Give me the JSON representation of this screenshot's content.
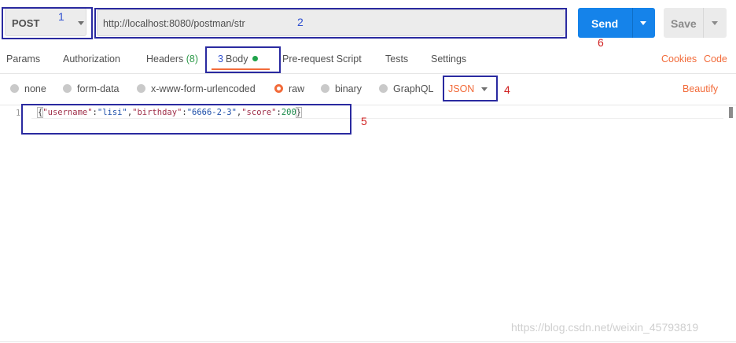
{
  "request": {
    "method": "POST",
    "url": "http://localhost:8080/postman/str",
    "send_label": "Send",
    "save_label": "Save"
  },
  "tabs": [
    {
      "label": "Params"
    },
    {
      "label": "Authorization"
    },
    {
      "label": "Headers",
      "badge": "(8)"
    },
    {
      "label": "Body",
      "active": true
    },
    {
      "label": "Pre-request Script"
    },
    {
      "label": "Tests"
    },
    {
      "label": "Settings"
    }
  ],
  "links": {
    "cookies": "Cookies",
    "code": "Code",
    "beautify": "Beautify"
  },
  "body_options": [
    {
      "label": "none"
    },
    {
      "label": "form-data"
    },
    {
      "label": "x-www-form-urlencoded"
    },
    {
      "label": "raw",
      "selected": true
    },
    {
      "label": "binary"
    },
    {
      "label": "GraphQL"
    }
  ],
  "body_format": "JSON",
  "editor": {
    "line_number": "1",
    "json": {
      "username": "lisi",
      "birthday": "6666-2-3",
      "score": "200"
    }
  },
  "annotations": [
    "1",
    "2",
    "3",
    "4",
    "5",
    "6"
  ],
  "watermark": "https://blog.csdn.net/weixin_45793819",
  "colors": {
    "accent_orange": "#f26b3a",
    "send_blue": "#1583ea",
    "annotation_box": "#2a2aa0"
  }
}
